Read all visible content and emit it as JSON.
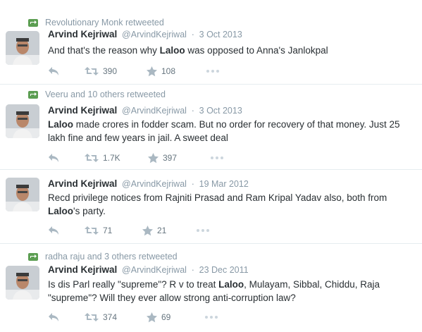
{
  "tweets": [
    {
      "retweeted_by": "Revolutionary Monk retweeted",
      "author_name": "Arvind Kejriwal",
      "author_handle": "@ArvindKejriwal",
      "separator": "·",
      "date": "3 Oct 2013",
      "text_segments": [
        {
          "text": "And that's the reason why ",
          "bold": false
        },
        {
          "text": "Laloo",
          "bold": true
        },
        {
          "text": " was opposed to Anna's Janlokpal",
          "bold": false
        }
      ],
      "retweets": "390",
      "favorites": "108"
    },
    {
      "retweeted_by": "Veeru and 10 others retweeted",
      "author_name": "Arvind Kejriwal",
      "author_handle": "@ArvindKejriwal",
      "separator": "·",
      "date": "3 Oct 2013",
      "text_segments": [
        {
          "text": "Laloo",
          "bold": true
        },
        {
          "text": " made crores in fodder scam. But no order for recovery of that money. Just 25 lakh fine and few years in jail. A sweet deal",
          "bold": false
        }
      ],
      "retweets": "1.7K",
      "favorites": "397"
    },
    {
      "retweeted_by": "",
      "author_name": "Arvind Kejriwal",
      "author_handle": "@ArvindKejriwal",
      "separator": "·",
      "date": "19 Mar 2012",
      "text_segments": [
        {
          "text": "Recd privilege notices from Rajniti Prasad and Ram Kripal Yadav also, both from ",
          "bold": false
        },
        {
          "text": "Laloo",
          "bold": true
        },
        {
          "text": "'s party.",
          "bold": false
        }
      ],
      "retweets": "71",
      "favorites": "21"
    },
    {
      "retweeted_by": "radha raju and 3 others retweeted",
      "author_name": "Arvind Kejriwal",
      "author_handle": "@ArvindKejriwal",
      "separator": "·",
      "date": "23 Dec 2011",
      "text_segments": [
        {
          "text": "Is dis Parl really \"supreme\"? R v to treat ",
          "bold": false
        },
        {
          "text": "Laloo",
          "bold": true
        },
        {
          "text": ", Mulayam, Sibbal, Chiddu, Raja \"supreme\"? Will they ever allow strong anti-corruption law?",
          "bold": false
        }
      ],
      "retweets": "374",
      "favorites": "69"
    }
  ],
  "colors": {
    "retweet_badge": "#5c9e52",
    "muted_text": "#8899a6",
    "action_icon": "#aab8c2",
    "body_text": "#292f33"
  },
  "icons": {
    "retweeted_badge": "retweet-icon",
    "reply": "reply-icon",
    "retweet": "retweet-icon",
    "favorite": "star-icon",
    "more": "more-dots-icon"
  }
}
